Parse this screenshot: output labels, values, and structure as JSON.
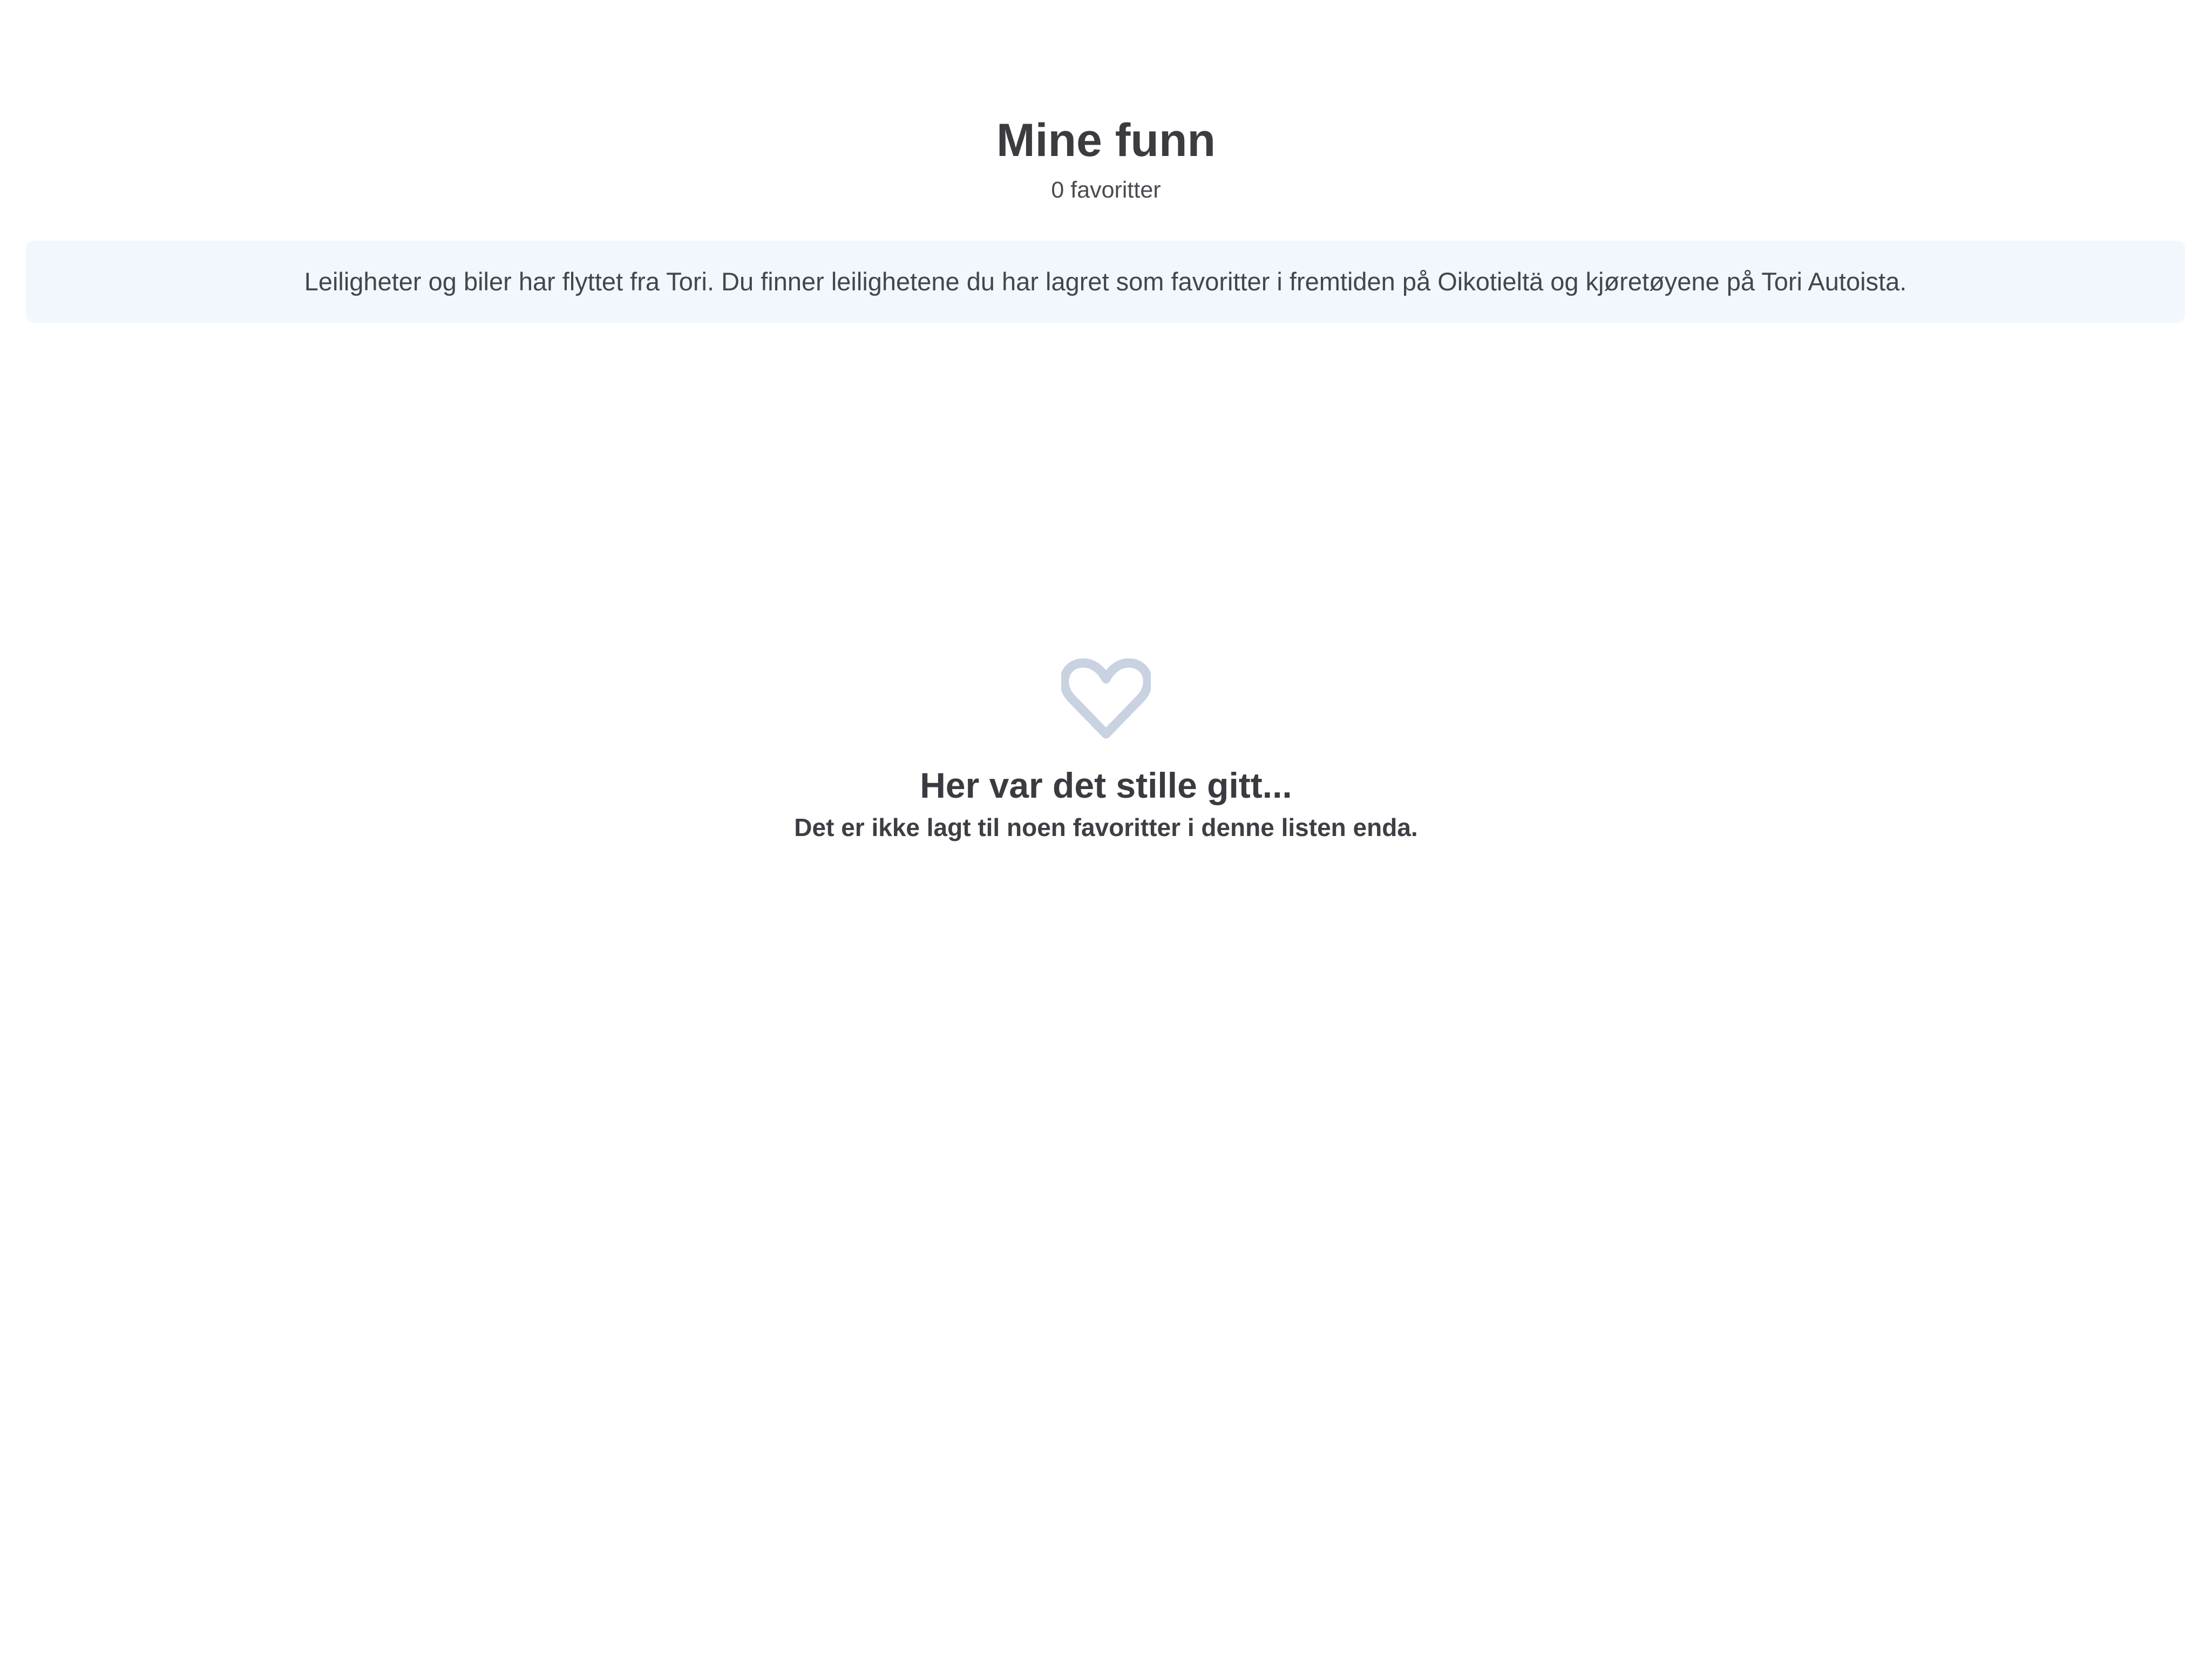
{
  "header": {
    "title": "Mine funn",
    "count_text": "0 favoritter"
  },
  "banner": {
    "text": "Leiligheter og biler har flyttet fra Tori. Du finner leilighetene du har lagret som favoritter i fremtiden på Oikotieltä og kjøretøyene på Tori Autoista."
  },
  "empty_state": {
    "icon": "heart-outline-icon",
    "title": "Her var det stille gitt...",
    "subtitle": "Det er ikke lagt til noen favoritter i denne listen enda."
  },
  "colors": {
    "banner_background": "#f1f7fd",
    "heart_icon": "#c8d2e0",
    "text": "#3a3a40"
  }
}
